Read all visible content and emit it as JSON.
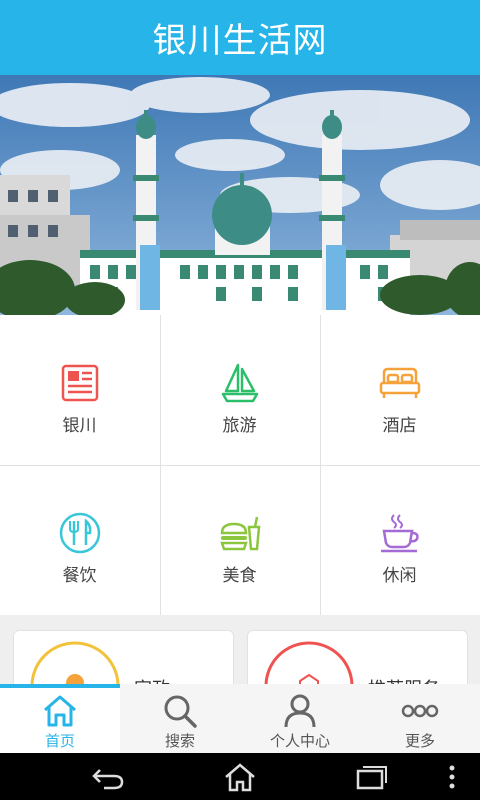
{
  "app": {
    "title": "银川生活网"
  },
  "colors": {
    "accent": "#27b4e8",
    "red": "#ef5350",
    "green": "#2bbf6a",
    "orange": "#f5a23a",
    "cyan": "#39c6d8",
    "lime": "#8cc63f",
    "purple": "#a46ad6"
  },
  "grid": {
    "items": [
      {
        "label": "银川",
        "icon": "newspaper-icon"
      },
      {
        "label": "旅游",
        "icon": "sailboat-icon"
      },
      {
        "label": "酒店",
        "icon": "bed-icon"
      },
      {
        "label": "餐饮",
        "icon": "fork-knife-icon"
      },
      {
        "label": "美食",
        "icon": "burger-drink-icon"
      },
      {
        "label": "休闲",
        "icon": "coffee-cup-icon"
      }
    ]
  },
  "cards": [
    {
      "label": "家政",
      "icon": "housekeeping-icon"
    },
    {
      "label": "推荐服务",
      "icon": "recommend-icon"
    }
  ],
  "tabs": [
    {
      "label": "首页",
      "icon": "home-icon",
      "active": true
    },
    {
      "label": "搜索",
      "icon": "search-icon",
      "active": false
    },
    {
      "label": "个人中心",
      "icon": "user-icon",
      "active": false
    },
    {
      "label": "更多",
      "icon": "more-icon",
      "active": false
    }
  ]
}
